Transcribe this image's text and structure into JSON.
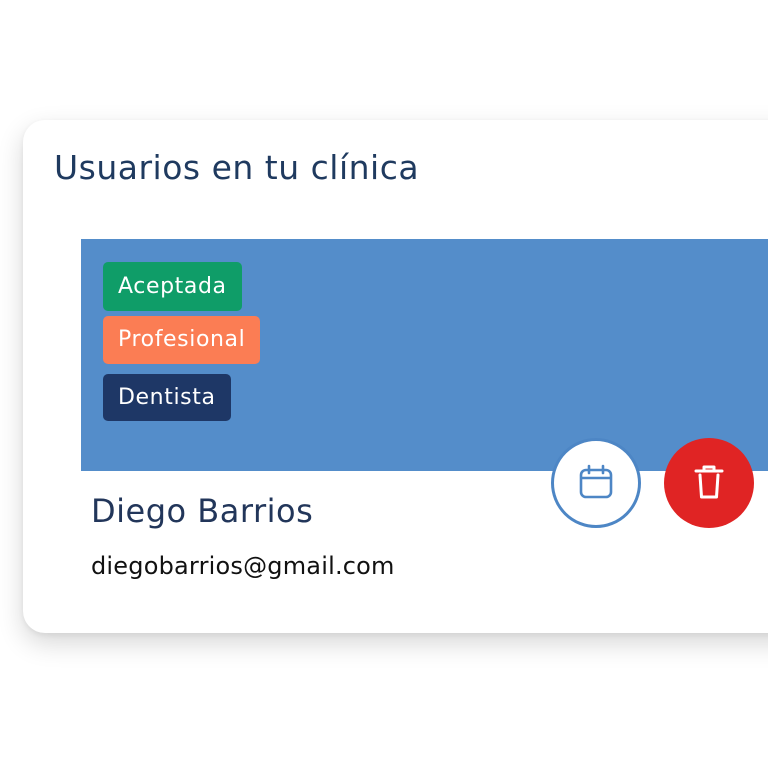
{
  "section": {
    "title": "Usuarios en tu clínica"
  },
  "user": {
    "name": "Diego Barrios",
    "email": "diegobarrios@gmail.com",
    "badges": [
      {
        "label": "Aceptada",
        "color": "#0f9d68"
      },
      {
        "label": "Profesional",
        "color": "#fb7d54"
      },
      {
        "label": "Dentista",
        "color": "#1e3766"
      }
    ]
  },
  "actions": {
    "calendar_icon": "calendar-icon",
    "delete_icon": "trash-icon"
  },
  "colors": {
    "card_header": "#548dca",
    "calendar_border": "#4d86c5",
    "delete": "#e02424",
    "title": "#1f3a5f"
  }
}
